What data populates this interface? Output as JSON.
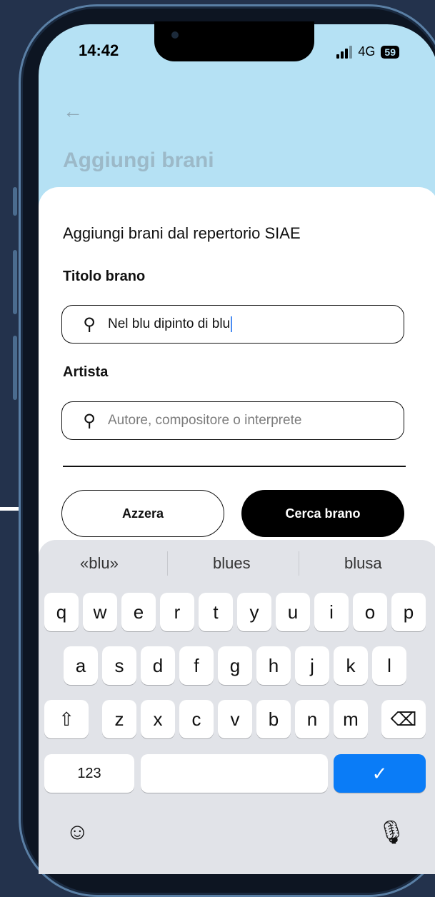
{
  "status_bar": {
    "time": "14:42",
    "network": "4G",
    "battery": "59"
  },
  "header": {
    "back_icon": "arrow-left-icon",
    "title": "Aggiungi brani"
  },
  "sheet": {
    "heading": "Aggiungi brani dal repertorio SIAE",
    "title_label": "Titolo brano",
    "title_value": "Nel blu dipinto di blu",
    "artist_label": "Artista",
    "artist_placeholder": "Autore, compositore o interprete",
    "reset_button": "Azzera",
    "search_button": "Cerca brano"
  },
  "keyboard": {
    "suggestions": [
      "«blu»",
      "blues",
      "blusa"
    ],
    "row1": [
      "q",
      "w",
      "e",
      "r",
      "t",
      "y",
      "u",
      "i",
      "o",
      "p"
    ],
    "row2": [
      "a",
      "s",
      "d",
      "f",
      "g",
      "h",
      "j",
      "k",
      "l"
    ],
    "row3": [
      "z",
      "x",
      "c",
      "v",
      "b",
      "n",
      "m"
    ],
    "numbers_key": "123",
    "enter_symbol": "✓",
    "accent_color": "#0a7cf7"
  }
}
